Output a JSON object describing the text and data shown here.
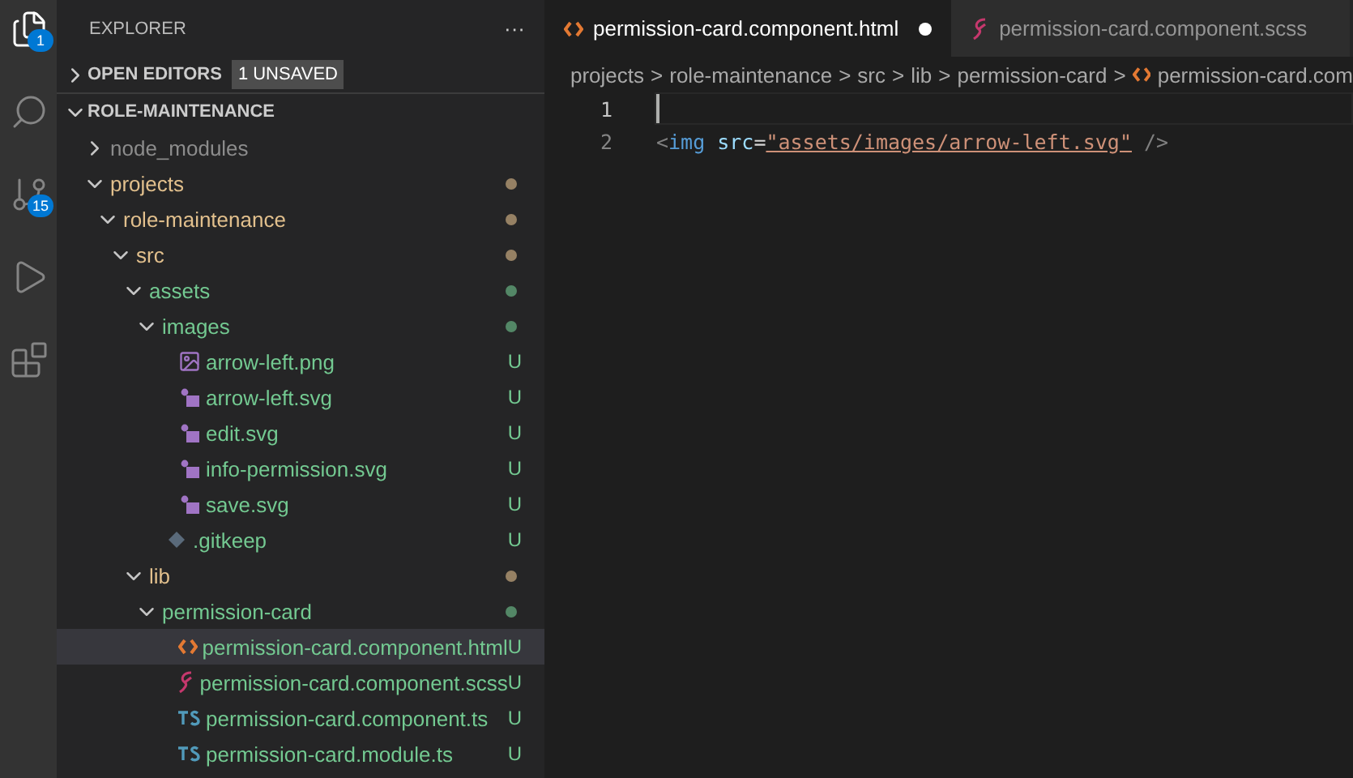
{
  "activity_bar": [
    {
      "kind": "files",
      "badge": "1",
      "selected": true
    },
    {
      "kind": "search",
      "selected": false
    },
    {
      "kind": "source-control",
      "badge": "15",
      "selected": false
    },
    {
      "kind": "run",
      "selected": false
    },
    {
      "kind": "extensions",
      "selected": false
    }
  ],
  "sidebar": {
    "title": "EXPLORER",
    "more": "···",
    "open_editors": {
      "label": "OPEN EDITORS",
      "badge": "1 UNSAVED",
      "expanded": false
    },
    "root": {
      "label": "ROLE-MAINTENANCE",
      "expanded": true
    },
    "tree": [
      {
        "name": "node_modules",
        "kind": "folder",
        "expanded": false,
        "color": "#8c8c8c",
        "selected": false
      },
      {
        "name": "projects",
        "kind": "folder",
        "expanded": true,
        "color": "#e2c08d",
        "modified": true,
        "selected": false,
        "children": [
          {
            "name": "role-maintenance",
            "kind": "folder",
            "expanded": true,
            "color": "#e2c08d",
            "modified": true,
            "selected": false,
            "children": [
              {
                "name": "src",
                "kind": "folder",
                "expanded": true,
                "color": "#e2c08d",
                "modified": true,
                "selected": false,
                "children": [
                  {
                    "name": "assets",
                    "kind": "folder",
                    "expanded": true,
                    "color": "#73c991",
                    "modified": true,
                    "selected": false,
                    "children": [
                      {
                        "name": "images",
                        "kind": "folder",
                        "expanded": true,
                        "color": "#73c991",
                        "modified": true,
                        "selected": false,
                        "children": [
                          {
                            "name": "arrow-left.png",
                            "kind": "image",
                            "color": "#73c991",
                            "status": "U",
                            "selected": false
                          },
                          {
                            "name": "arrow-left.svg",
                            "kind": "svg",
                            "color": "#73c991",
                            "status": "U",
                            "selected": false
                          },
                          {
                            "name": "edit.svg",
                            "kind": "svg",
                            "color": "#73c991",
                            "status": "U",
                            "selected": false
                          },
                          {
                            "name": "info-permission.svg",
                            "kind": "svg",
                            "color": "#73c991",
                            "status": "U",
                            "selected": false
                          },
                          {
                            "name": "save.svg",
                            "kind": "svg",
                            "color": "#73c991",
                            "status": "U",
                            "selected": false
                          }
                        ]
                      },
                      {
                        "name": ".gitkeep",
                        "kind": "git",
                        "color": "#73c991",
                        "status": "U",
                        "selected": false
                      }
                    ]
                  },
                  {
                    "name": "lib",
                    "kind": "folder",
                    "expanded": true,
                    "color": "#e2c08d",
                    "modified": true,
                    "selected": false,
                    "children": [
                      {
                        "name": "permission-card",
                        "kind": "folder",
                        "expanded": true,
                        "color": "#73c991",
                        "modified": true,
                        "selected": false,
                        "children": [
                          {
                            "name": "permission-card.component.html",
                            "kind": "html",
                            "color": "#73c991",
                            "status": "U",
                            "selected": true
                          },
                          {
                            "name": "permission-card.component.scss",
                            "kind": "scss",
                            "color": "#73c991",
                            "status": "U",
                            "selected": false
                          },
                          {
                            "name": "permission-card.component.ts",
                            "kind": "ts",
                            "color": "#73c991",
                            "status": "U",
                            "selected": false
                          },
                          {
                            "name": "permission-card.module.ts",
                            "kind": "ts",
                            "color": "#73c991",
                            "status": "U",
                            "selected": false
                          }
                        ]
                      }
                    ]
                  }
                ]
              }
            ]
          }
        ]
      }
    ]
  },
  "tabs": [
    {
      "label": "permission-card.component.html",
      "kind": "html",
      "selected": true,
      "dirty": true
    },
    {
      "label": "permission-card.component.scss",
      "kind": "scss",
      "selected": false,
      "dirty": false
    }
  ],
  "breadcrumbs": [
    {
      "label": "projects"
    },
    {
      "label": "role-maintenance"
    },
    {
      "label": "src"
    },
    {
      "label": "lib"
    },
    {
      "label": "permission-card"
    },
    {
      "label": "permission-card.com",
      "kind": "html"
    }
  ],
  "breadcrumb_separator": ">",
  "code": [
    {
      "number": "1",
      "current": true
    },
    {
      "number": "2",
      "current": false,
      "tokens": [
        {
          "kind": "punct",
          "text": "<"
        },
        {
          "kind": "tag",
          "text": "img"
        },
        {
          "kind": "attr",
          "text": "src"
        },
        {
          "kind": "plain",
          "text": "="
        },
        {
          "kind": "string",
          "text": "\"assets/images/arrow-left.svg\""
        },
        {
          "kind": "punct",
          "text": "/>"
        }
      ]
    }
  ]
}
